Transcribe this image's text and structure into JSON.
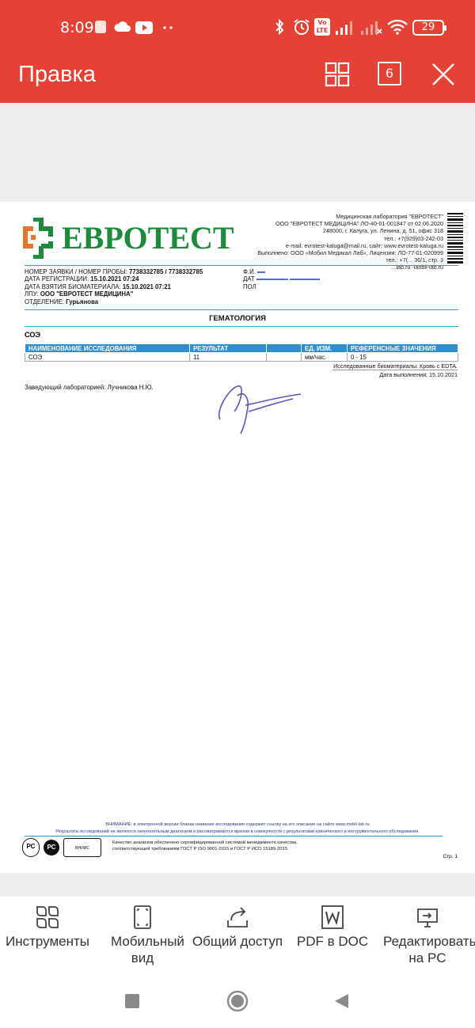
{
  "status_bar": {
    "time": "8:09",
    "battery": "29",
    "volte_top": "Vo",
    "volte_bottom": "LTE"
  },
  "app_bar": {
    "title": "Правка",
    "page_count": "6"
  },
  "document": {
    "logo_text": "ЕВРОТЕСТ",
    "lab_info": [
      "Медицинская лаборатория \"ЕВРОТЕСТ\"",
      "ООО \"ЕВРОТЕСТ МЕДИЦИНА\" ЛО-40-01-001847 от 02.06.2020",
      "248000, г. Калуга, ул. Ленина, д. 51, офис 318",
      "тел.: +7(929)03-242-03",
      "e-mail: evrotest-kaluga@mail.ru, сайт: www.evrotest-kaluga.ru",
      "Выполнено: ООО «Мобил Медикал Лаб», Лицензия: ЛО-77-01-020999",
      "тел.: +7(... 36/1, стр. 3",
      "...lab.ru -lаоbil-lab.ru"
    ],
    "request": {
      "label_number": "НОМЕР ЗАЯВКИ / НОМЕР ПРОБЫ:",
      "value_number": "7738332785 / 7738332785",
      "label_reg": "ДАТА РЕГИСТРАЦИИ:",
      "value_reg": "15.10.2021 07:24",
      "label_bio": "ДАТА ВЗЯТИЯ БИОМАТЕРИАЛА:",
      "value_bio": "15.10.2021 07:21",
      "label_lpu": "ЛПУ:",
      "value_lpu": "ООО \"ЕВРОТЕСТ МЕДИЦИНА\"",
      "label_dept": "ОТДЕЛЕНИЕ:",
      "value_dept": "Гурьянова"
    },
    "patient": {
      "label_fio": "Ф.И.",
      "label_dob": "ДАТ",
      "label_sex": "ПОЛ"
    },
    "section_title": "ГЕМАТОЛОГИЯ",
    "test_name": "СОЭ",
    "table": {
      "headers": [
        "НАИМЕНОВАНИЕ ИССЛЕДОВАНИЯ",
        "РЕЗУЛЬТАТ",
        "",
        "ЕД. ИЗМ.",
        "РЕФЕРЕНСНЫЕ ЗНАЧЕНИЯ"
      ],
      "rows": [
        [
          "СОЭ",
          "11",
          "",
          "мм/час.",
          "0 - 15"
        ]
      ]
    },
    "biomaterial": "Исследованные биоматериалы: Кровь с EDTA.",
    "exec_date": "Дата выполнения: 15.10.2021",
    "head_of_lab": "Заведующий лабораторией: Лучникова Н.Ю.",
    "footer_warning": "ВНИМАНИЕ: в электронной версии бланка название исследования содержит ссылку на его описание на сайте www.mobil-lab.ru",
    "footer_disclaimer": "Результаты исследований не являются окончательным диагнозом и рассматриваются врачом в совокупности с результатами клинического и инструментального обследования.",
    "footer_quality_1": "Качество анализов обеспечено сертифицированной системой менеджмента качества,",
    "footer_quality_2": "соответствующей требованиям ГОСТ Р ISO 9001-2015 и ГОСТ Р ИСО 15189-2015.",
    "footer_logo_1": "РС",
    "footer_logo_2": "ВНИИС",
    "page_label": "Стр. 1"
  },
  "toolbar": {
    "items": [
      {
        "label": "Инструменты",
        "icon": "tools-grid-icon"
      },
      {
        "label": "Мобильный вид",
        "icon": "mobile-view-icon"
      },
      {
        "label": "Общий доступ",
        "icon": "share-icon"
      },
      {
        "label": "PDF в DOC",
        "icon": "word-doc-icon"
      },
      {
        "label": "Редактировать на PC",
        "icon": "cast-to-pc-icon"
      }
    ]
  },
  "colors": {
    "accent": "#e34234",
    "logo_green": "#1e8a3c",
    "table_header": "#2e8fd0"
  }
}
